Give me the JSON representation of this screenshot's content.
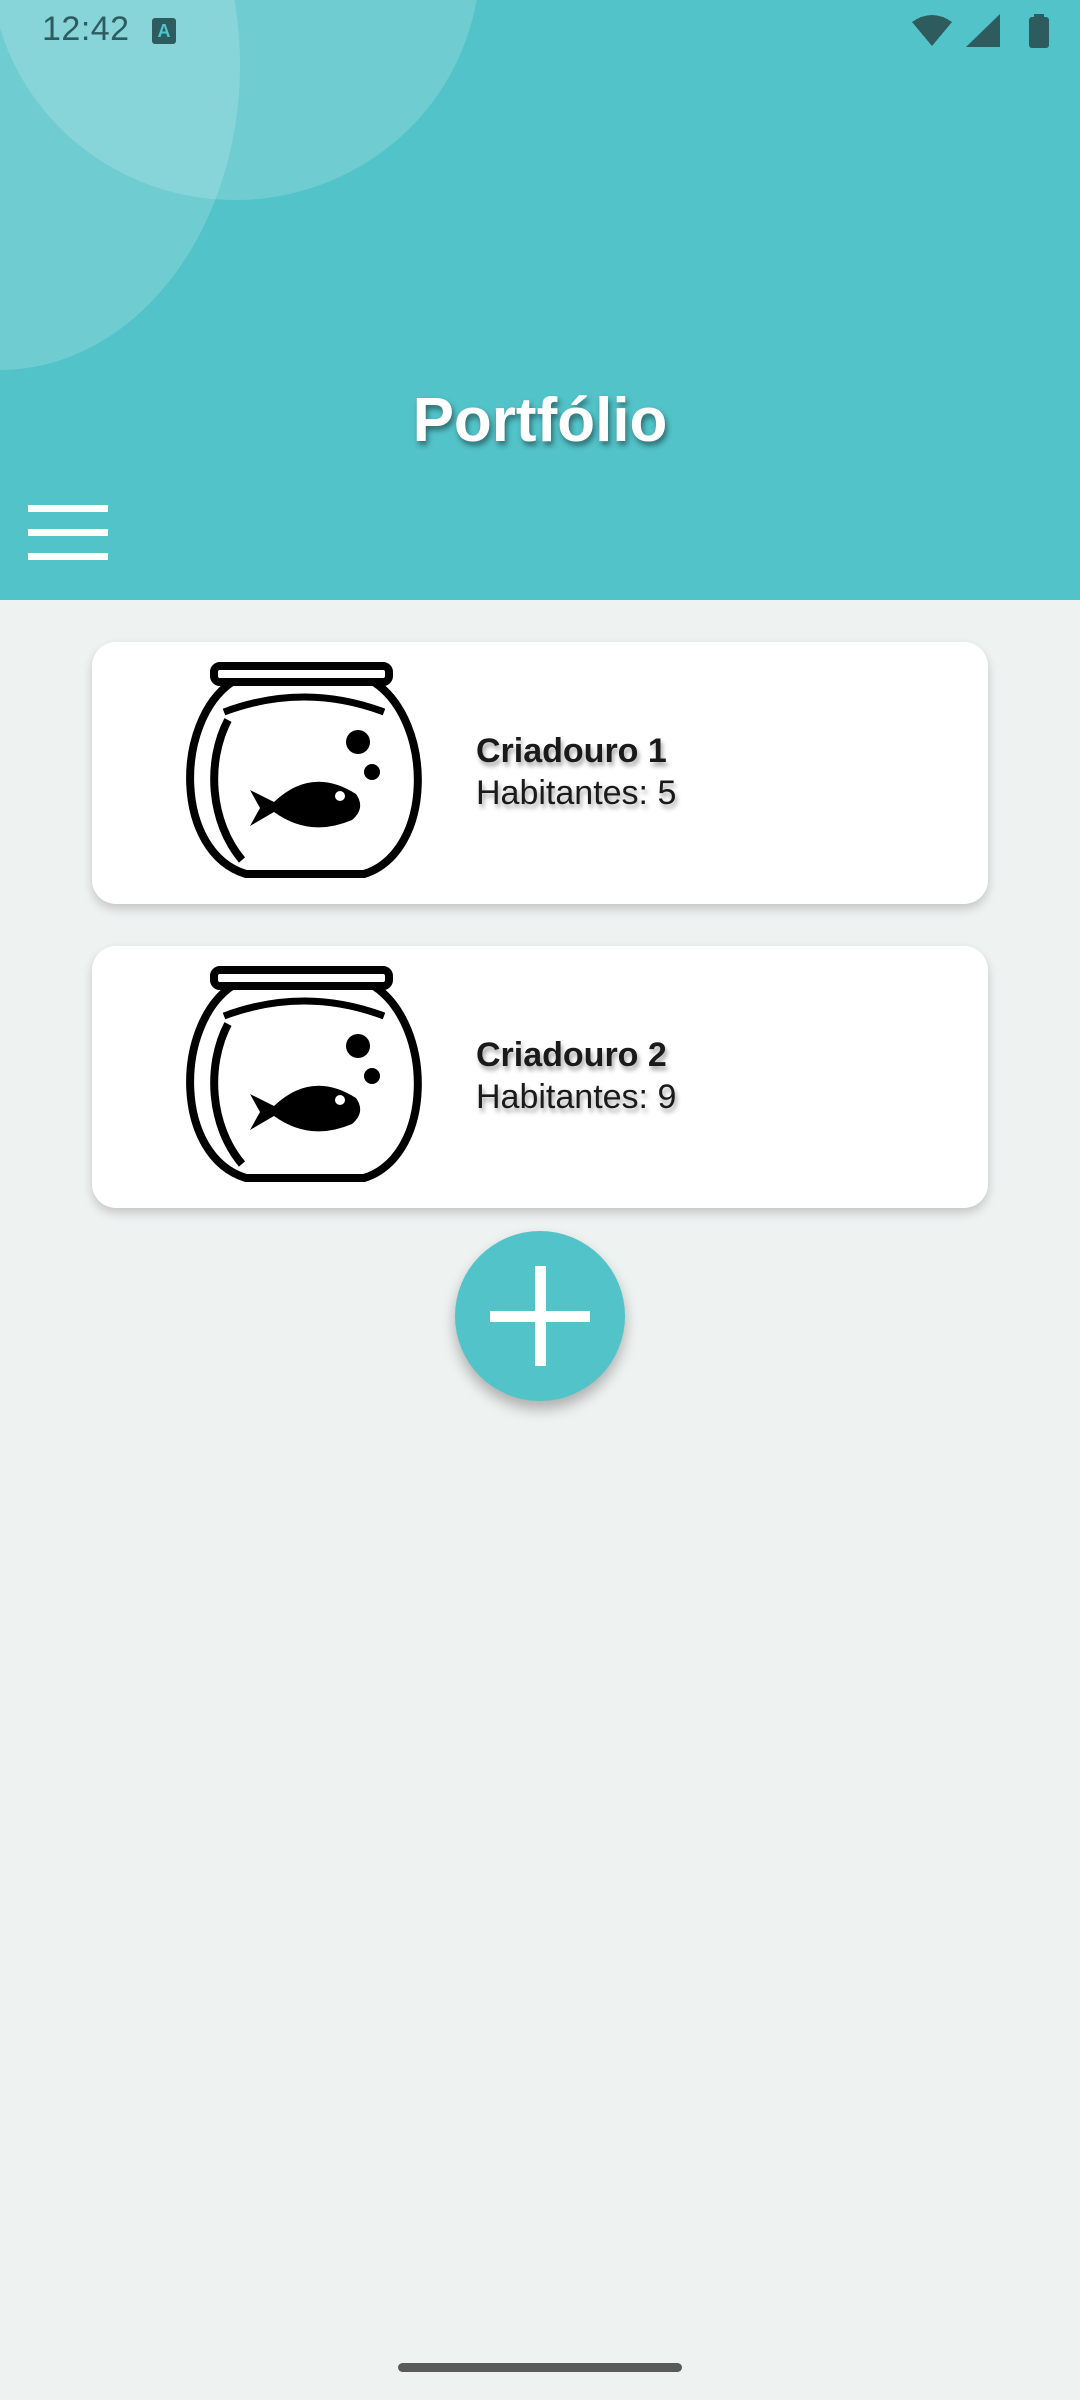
{
  "status_bar": {
    "time": "12:42",
    "notification_icon": "a-icon",
    "icons": [
      "wifi-icon",
      "signal-icon",
      "battery-icon"
    ]
  },
  "header": {
    "title": "Portfólio",
    "menu_icon": "hamburger-menu-icon"
  },
  "tanks": [
    {
      "name": "Criadouro 1",
      "inhabitants": "Habitantes: 5",
      "icon": "fishbowl-icon"
    },
    {
      "name": "Criadouro 2",
      "inhabitants": "Habitantes: 9",
      "icon": "fishbowl-icon"
    }
  ],
  "fab": {
    "icon": "plus-icon"
  },
  "colors": {
    "accent": "#52c3c9",
    "background": "#eef2f1",
    "card": "#ffffff"
  }
}
